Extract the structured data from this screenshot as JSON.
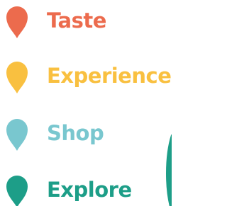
{
  "items": [
    {
      "label": "Taste",
      "color": "#ec6b4d",
      "icon": "map-pin-icon"
    },
    {
      "label": "Experience",
      "color": "#f9c040",
      "icon": "map-pin-icon"
    },
    {
      "label": "Shop",
      "color": "#79c7cf",
      "icon": "map-pin-icon"
    },
    {
      "label": "Explore",
      "color": "#1d9e88",
      "icon": "map-pin-icon"
    }
  ],
  "decoration": {
    "arc_color": "#1d9e88"
  }
}
